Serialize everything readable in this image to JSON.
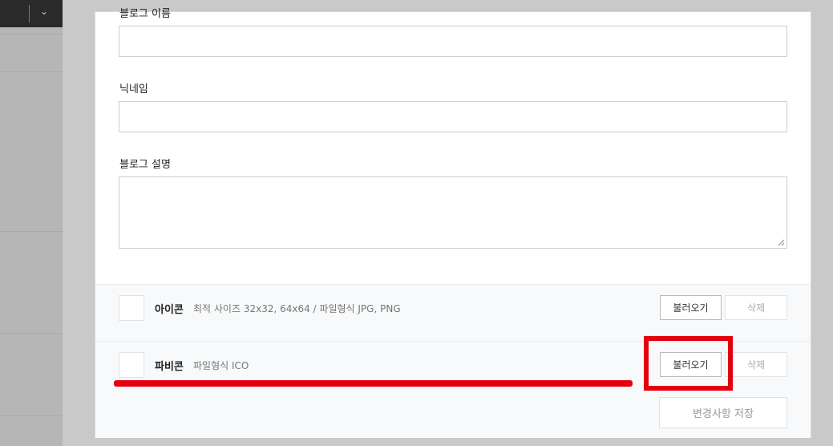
{
  "form": {
    "blog_name_label": "블로그 이름",
    "blog_name_value": "",
    "nickname_label": "닉네임",
    "nickname_value": "",
    "blog_description_label": "블로그 설명",
    "blog_description_value": ""
  },
  "icon_row": {
    "title": "아이콘",
    "description": "최적 사이즈 32x32, 64x64 / 파일형식 JPG, PNG",
    "load_button": "불러오기",
    "delete_button": "삭제"
  },
  "favicon_row": {
    "title": "파비콘",
    "description": "파일형식 ICO",
    "load_button": "불러오기",
    "delete_button": "삭제"
  },
  "footer": {
    "save_button": "변경사항 저장"
  },
  "annotation": {
    "highlight_color": "#e4000f"
  },
  "icons": {
    "topbar_dropdown": "chevron-down-icon",
    "textarea_resize": "resize-handle-icon"
  }
}
